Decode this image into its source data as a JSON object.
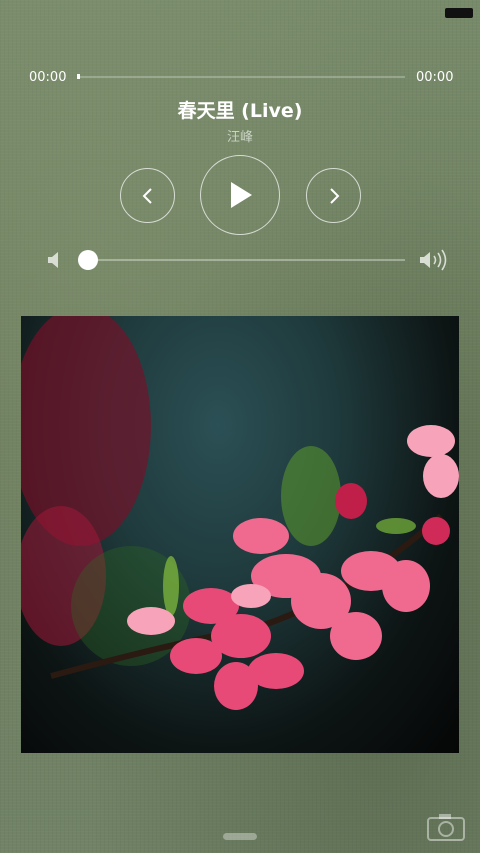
{
  "player": {
    "time_elapsed": "00:00",
    "time_total": "00:00",
    "progress": 0,
    "title": "春天里 (Live)",
    "artist": "汪峰",
    "volume": 0
  },
  "icons": {
    "prev": "chevron-left-icon",
    "play": "play-icon",
    "next": "chevron-right-icon",
    "volume_low": "volume-low-icon",
    "volume_high": "volume-high-icon",
    "camera": "camera-icon"
  },
  "colors": {
    "background": "#6d7d5f",
    "text": "#ffffff"
  }
}
